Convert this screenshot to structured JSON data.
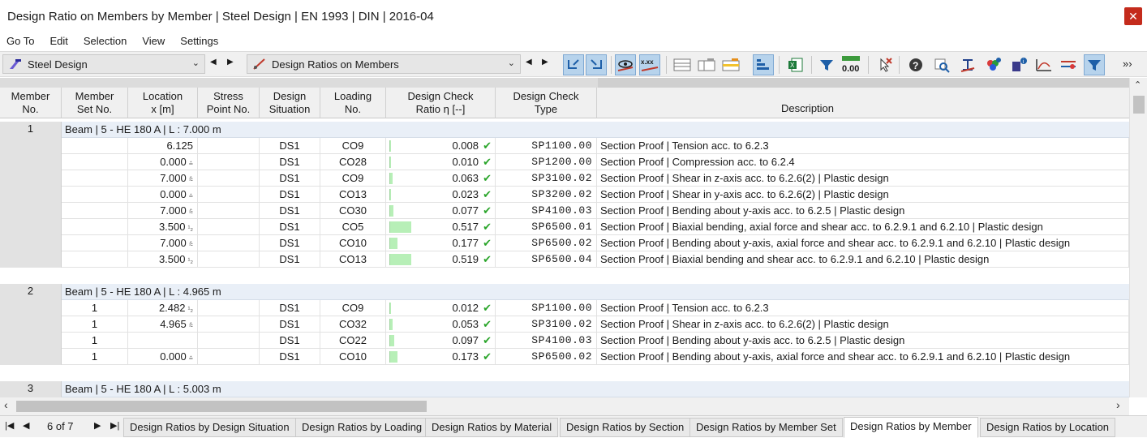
{
  "window": {
    "title": "Design Ratio on Members by Member | Steel Design | EN 1993 | DIN | 2016-04",
    "close_label": "✕"
  },
  "menu": [
    "Go To",
    "Edit",
    "Selection",
    "View",
    "Settings"
  ],
  "toolbar": {
    "module_combo": "Steel Design",
    "table_combo": "Design Ratios on Members",
    "more": "»›"
  },
  "columns": {
    "member_no": [
      "Member",
      "No."
    ],
    "member_set_no": [
      "Member",
      "Set No."
    ],
    "location": [
      "Location",
      "x [m]"
    ],
    "stress_point": [
      "Stress",
      "Point No."
    ],
    "design_situation": [
      "Design",
      "Situation"
    ],
    "loading_no": [
      "Loading",
      "No."
    ],
    "ratio": [
      "Design Check",
      "Ratio η [--]"
    ],
    "check_type": [
      "Design Check",
      "Type"
    ],
    "description": "Description"
  },
  "groups": [
    {
      "member_no": "1",
      "label": "Beam | 5 - HE 180 A | L : 7.000 m",
      "rows": [
        {
          "set_no": "",
          "location": "6.125",
          "loc_mark": "",
          "stress_point": "",
          "ds": "DS1",
          "loading": "CO9",
          "ratio": "0.008",
          "ratio_value": 0.008,
          "type": "SP1100.00",
          "description": "Section Proof | Tension acc. to 6.2.3"
        },
        {
          "set_no": "",
          "location": "0.000",
          "loc_mark": "⩮",
          "stress_point": "",
          "ds": "DS1",
          "loading": "CO28",
          "ratio": "0.010",
          "ratio_value": 0.01,
          "type": "SP1200.00",
          "description": "Section Proof | Compression acc. to 6.2.4"
        },
        {
          "set_no": "",
          "location": "7.000",
          "loc_mark": "⩯",
          "stress_point": "",
          "ds": "DS1",
          "loading": "CO9",
          "ratio": "0.063",
          "ratio_value": 0.063,
          "type": "SP3100.02",
          "description": "Section Proof | Shear in z-axis acc. to 6.2.6(2) | Plastic design"
        },
        {
          "set_no": "",
          "location": "0.000",
          "loc_mark": "⩮",
          "stress_point": "",
          "ds": "DS1",
          "loading": "CO13",
          "ratio": "0.023",
          "ratio_value": 0.023,
          "type": "SP3200.02",
          "description": "Section Proof | Shear in y-axis acc. to 6.2.6(2) | Plastic design"
        },
        {
          "set_no": "",
          "location": "7.000",
          "loc_mark": "⩯",
          "stress_point": "",
          "ds": "DS1",
          "loading": "CO30",
          "ratio": "0.077",
          "ratio_value": 0.077,
          "type": "SP4100.03",
          "description": "Section Proof | Bending about y-axis acc. to 6.2.5 | Plastic design"
        },
        {
          "set_no": "",
          "location": "3.500",
          "loc_mark": "¹₂",
          "stress_point": "",
          "ds": "DS1",
          "loading": "CO5",
          "ratio": "0.517",
          "ratio_value": 0.517,
          "type": "SP6500.01",
          "description": "Section Proof | Biaxial bending, axial force and shear acc. to 6.2.9.1 and 6.2.10 | Plastic design"
        },
        {
          "set_no": "",
          "location": "7.000",
          "loc_mark": "⩯",
          "stress_point": "",
          "ds": "DS1",
          "loading": "CO10",
          "ratio": "0.177",
          "ratio_value": 0.177,
          "type": "SP6500.02",
          "description": "Section Proof | Bending about y-axis, axial force and shear acc. to 6.2.9.1 and 6.2.10 | Plastic design"
        },
        {
          "set_no": "",
          "location": "3.500",
          "loc_mark": "¹₂",
          "stress_point": "",
          "ds": "DS1",
          "loading": "CO13",
          "ratio": "0.519",
          "ratio_value": 0.519,
          "type": "SP6500.04",
          "description": "Section Proof | Biaxial bending and shear acc. to 6.2.9.1 and 6.2.10 | Plastic design"
        }
      ]
    },
    {
      "member_no": "2",
      "label": "Beam | 5 - HE 180 A | L : 4.965 m",
      "rows": [
        {
          "set_no": "1",
          "location": "2.482",
          "loc_mark": "¹₂",
          "stress_point": "",
          "ds": "DS1",
          "loading": "CO9",
          "ratio": "0.012",
          "ratio_value": 0.012,
          "type": "SP1100.00",
          "description": "Section Proof | Tension acc. to 6.2.3"
        },
        {
          "set_no": "1",
          "location": "4.965",
          "loc_mark": "⩯",
          "stress_point": "",
          "ds": "DS1",
          "loading": "CO32",
          "ratio": "0.053",
          "ratio_value": 0.053,
          "type": "SP3100.02",
          "description": "Section Proof | Shear in z-axis acc. to 6.2.6(2) | Plastic design"
        },
        {
          "set_no": "1",
          "location": "",
          "loc_mark": "",
          "stress_point": "",
          "ds": "DS1",
          "loading": "CO22",
          "ratio": "0.097",
          "ratio_value": 0.097,
          "type": "SP4100.03",
          "description": "Section Proof | Bending about y-axis acc. to 6.2.5 | Plastic design"
        },
        {
          "set_no": "1",
          "location": "0.000",
          "loc_mark": "⩮",
          "stress_point": "",
          "ds": "DS1",
          "loading": "CO10",
          "ratio": "0.173",
          "ratio_value": 0.173,
          "type": "SP6500.02",
          "description": "Section Proof | Bending about y-axis, axial force and shear acc. to 6.2.9.1 and 6.2.10 | Plastic design"
        }
      ]
    },
    {
      "member_no": "3",
      "label": "Beam | 5 - HE 180 A | L : 5.003 m",
      "rows": []
    }
  ],
  "pager": {
    "text": "6 of 7"
  },
  "tabs": [
    "Design Ratios by Design Situation",
    "Design Ratios by Loading",
    "Design Ratios by Material",
    "Design Ratios by Section",
    "Design Ratios by Member Set",
    "Design Ratios by Member",
    "Design Ratios by Location"
  ],
  "active_tab": "Design Ratios by Member",
  "colors": {
    "ratio_bar": "#b7efb7",
    "check": "#2aa52a",
    "group_row": "#e9eff7",
    "active_toolbar": "#b7d3ec"
  }
}
